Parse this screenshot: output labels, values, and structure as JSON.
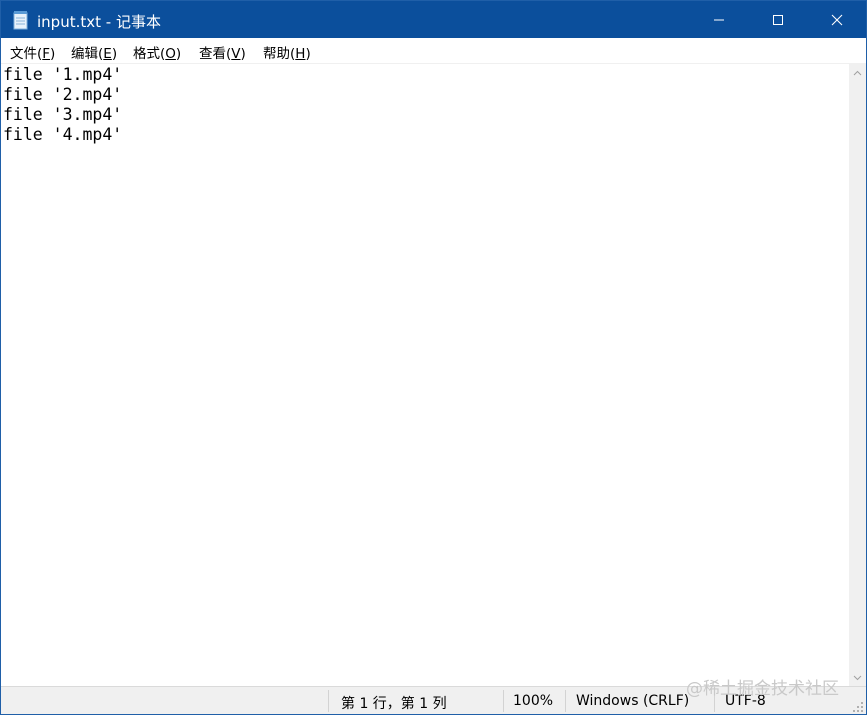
{
  "window": {
    "title": "input.txt - 记事本",
    "title_bar_color": "#0b4f9c",
    "controls": {
      "minimize_icon": "minimize-icon",
      "maximize_icon": "maximize-icon",
      "close_icon": "close-icon"
    }
  },
  "menu": {
    "file": {
      "label": "文件(",
      "key": "F",
      "end": ")"
    },
    "edit": {
      "label": "编辑(",
      "key": "E",
      "end": ")"
    },
    "format": {
      "label": "格式(",
      "key": "O",
      "end": ")"
    },
    "view": {
      "label": "查看(",
      "key": "V",
      "end": ")"
    },
    "help": {
      "label": "帮助(",
      "key": "H",
      "end": ")"
    }
  },
  "editor": {
    "lines": [
      "file '1.mp4'",
      "file '2.mp4'",
      "file '3.mp4'",
      "file '4.mp4'"
    ]
  },
  "statusbar": {
    "position": "第 1 行，第 1 列",
    "zoom": "100%",
    "line_ending": "Windows (CRLF)",
    "encoding": "UTF-8"
  },
  "watermark": "@稀土掘金技术社区"
}
